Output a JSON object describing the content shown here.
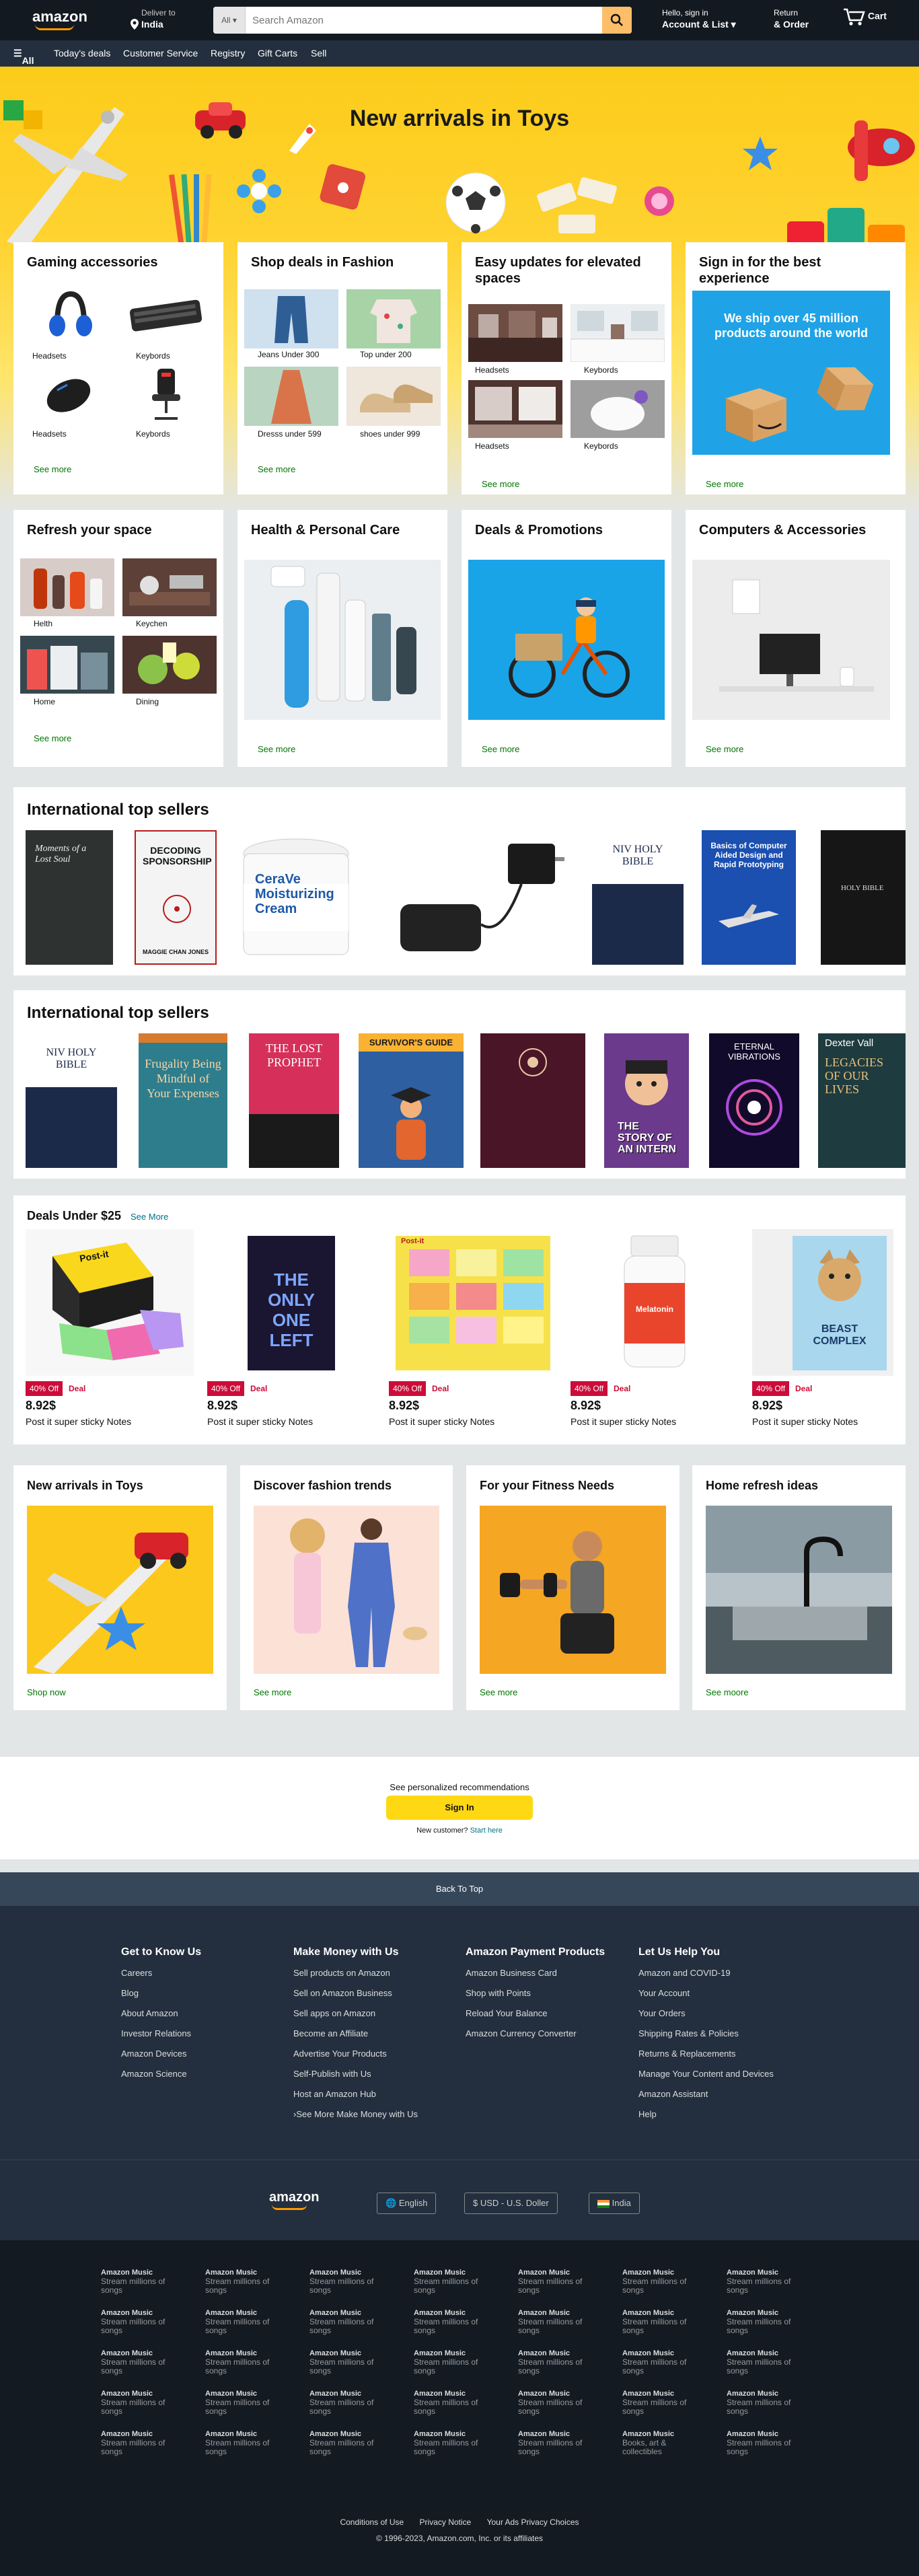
{
  "nav": {
    "logo": "amazon",
    "deliver_to": "Deliver to",
    "deliver_location": "India",
    "search_category": "All",
    "search_placeholder": "Search Amazon",
    "account_greeting": "Hello, sign in",
    "account_label": "Account & List",
    "returns_line1": "Return",
    "returns_line2": "& Order",
    "cart_label": "Cart"
  },
  "subnav": {
    "all": "All",
    "items": [
      "Today's deals",
      "Customer Service",
      "Registry",
      "Gift Carts",
      "Sell"
    ]
  },
  "hero": {
    "title": "New arrivals in Toys"
  },
  "row1": [
    {
      "title": "Gaming accessories",
      "items": [
        "Headsets",
        "Keybords",
        "Headsets",
        "Keybords"
      ],
      "see": "See more"
    },
    {
      "title": "Shop deals in Fashion",
      "items": [
        "Jeans Under 300",
        "Top under 200",
        "Dresss under 599",
        "shoes under 999"
      ],
      "see": "See more"
    },
    {
      "title": "Easy updates for elevated spaces",
      "items": [
        "Headsets",
        "Keybords",
        "Headsets",
        "Keybords"
      ],
      "see": "See more"
    },
    {
      "title": "Sign in for the best experience",
      "banner": "We ship over 45 million products around the world",
      "see": "See more"
    }
  ],
  "row2": [
    {
      "title": "Refresh your space",
      "items": [
        "Helth",
        "Keychen",
        "Home",
        "Dining"
      ],
      "see": "See more"
    },
    {
      "title": "Health & Personal Care",
      "see": "See more"
    },
    {
      "title": "Deals & Promotions",
      "see": "See more"
    },
    {
      "title": "Computers & Accessories",
      "see": "See more"
    }
  ],
  "sellers1": {
    "title": "International top sellers",
    "books": [
      "Moments of a Lost Soul",
      "DECODING SPONSORSHIP",
      "CeraVe Moisturizing Cream",
      "",
      "NIV HOLY BIBLE",
      "Basics of Computer Aided Design and Rapid Prototyping",
      "HOLY BIBLE"
    ],
    "book_sub": [
      "",
      "MAGGIE CHAN JONES",
      "",
      "",
      "",
      "",
      ""
    ]
  },
  "sellers2": {
    "title": "International top sellers",
    "books": [
      "NIV HOLY BIBLE",
      "Frugality Being Mindful of Your Expenses",
      "THE LOST PROPHET",
      "SURVIVOR'S GUIDE",
      "",
      "THE STORY OF AN INTERN",
      "ETERNAL VIBRATIONS",
      "LEGACIES OF OUR LIVES"
    ],
    "book_sub": [
      "",
      "",
      "",
      "",
      "",
      "",
      "",
      "Dexter Vall"
    ]
  },
  "deals": {
    "title": "Deals Under $25",
    "see_more": "See More",
    "badge": "40% Off",
    "deal_label": "Deal",
    "items": [
      {
        "price": "8.92$",
        "name": "Post it super sticky Notes",
        "cover": "Post-it"
      },
      {
        "price": "8.92$",
        "name": "Post it super sticky Notes",
        "cover": "THE ONLY ONE LEFT"
      },
      {
        "price": "8.92$",
        "name": "Post it super sticky Notes",
        "cover": "Post-it"
      },
      {
        "price": "8.92$",
        "name": "Post it super sticky Notes",
        "cover": "Melatonin"
      },
      {
        "price": "8.92$",
        "name": "Post it super sticky Notes",
        "cover": "BEAST COMPLEX"
      }
    ]
  },
  "row3": [
    {
      "title": "New arrivals in Toys",
      "see": "Shop now"
    },
    {
      "title": "Discover fashion trends",
      "see": "See more"
    },
    {
      "title": "For your Fitness Needs",
      "see": "See more"
    },
    {
      "title": "Home refresh ideas",
      "see": "See moore"
    }
  ],
  "signin": {
    "prompt": "See personalized recommendations",
    "button": "Sign In",
    "new_customer": "New customer?",
    "start_here": "Start here"
  },
  "back_to_top": "Back To Top",
  "footer_cols": [
    {
      "title": "Get to Know Us",
      "links": [
        "Careers",
        "Blog",
        "About Amazon",
        "Investor Relations",
        "Amazon Devices",
        "Amazon Science"
      ]
    },
    {
      "title": "Make Money with Us",
      "links": [
        "Sell products on Amazon",
        "Sell on Amazon Business",
        "Sell apps on Amazon",
        "Become an Affiliate",
        "Advertise Your Products",
        "Self-Publish with Us",
        "Host an Amazon Hub",
        "›See More Make Money with Us"
      ]
    },
    {
      "title": "Amazon Payment Products",
      "links": [
        "Amazon Business Card",
        "Shop with Points",
        "Reload Your Balance",
        "Amazon Currency Converter"
      ]
    },
    {
      "title": "Let Us Help You",
      "links": [
        "Amazon and COVID-19",
        "Your Account",
        "Your Orders",
        "Shipping Rates & Policies",
        "Returns & Replacements",
        "Manage Your Content and Devices",
        "Amazon Assistant",
        "Help"
      ]
    }
  ],
  "locale": {
    "logo": "amazon",
    "language": "English",
    "currency": "$ USD - U.S. Doller",
    "country": "India"
  },
  "music": {
    "title": "Amazon Music",
    "sub": "Stream millions of songs",
    "alt_sub": "Books, art & collectibles"
  },
  "legal": {
    "links": [
      "Conditions of Use",
      "Privacy Notice",
      "Your Ads Privacy Choices"
    ],
    "copyright": "© 1996-2023, Amazon.com, Inc. or its affiliates"
  },
  "colors": {
    "nav": "#131921",
    "subnav": "#232f3e",
    "accent": "#febd69",
    "link_green": "#007600",
    "deal_red": "#cc0c39"
  }
}
